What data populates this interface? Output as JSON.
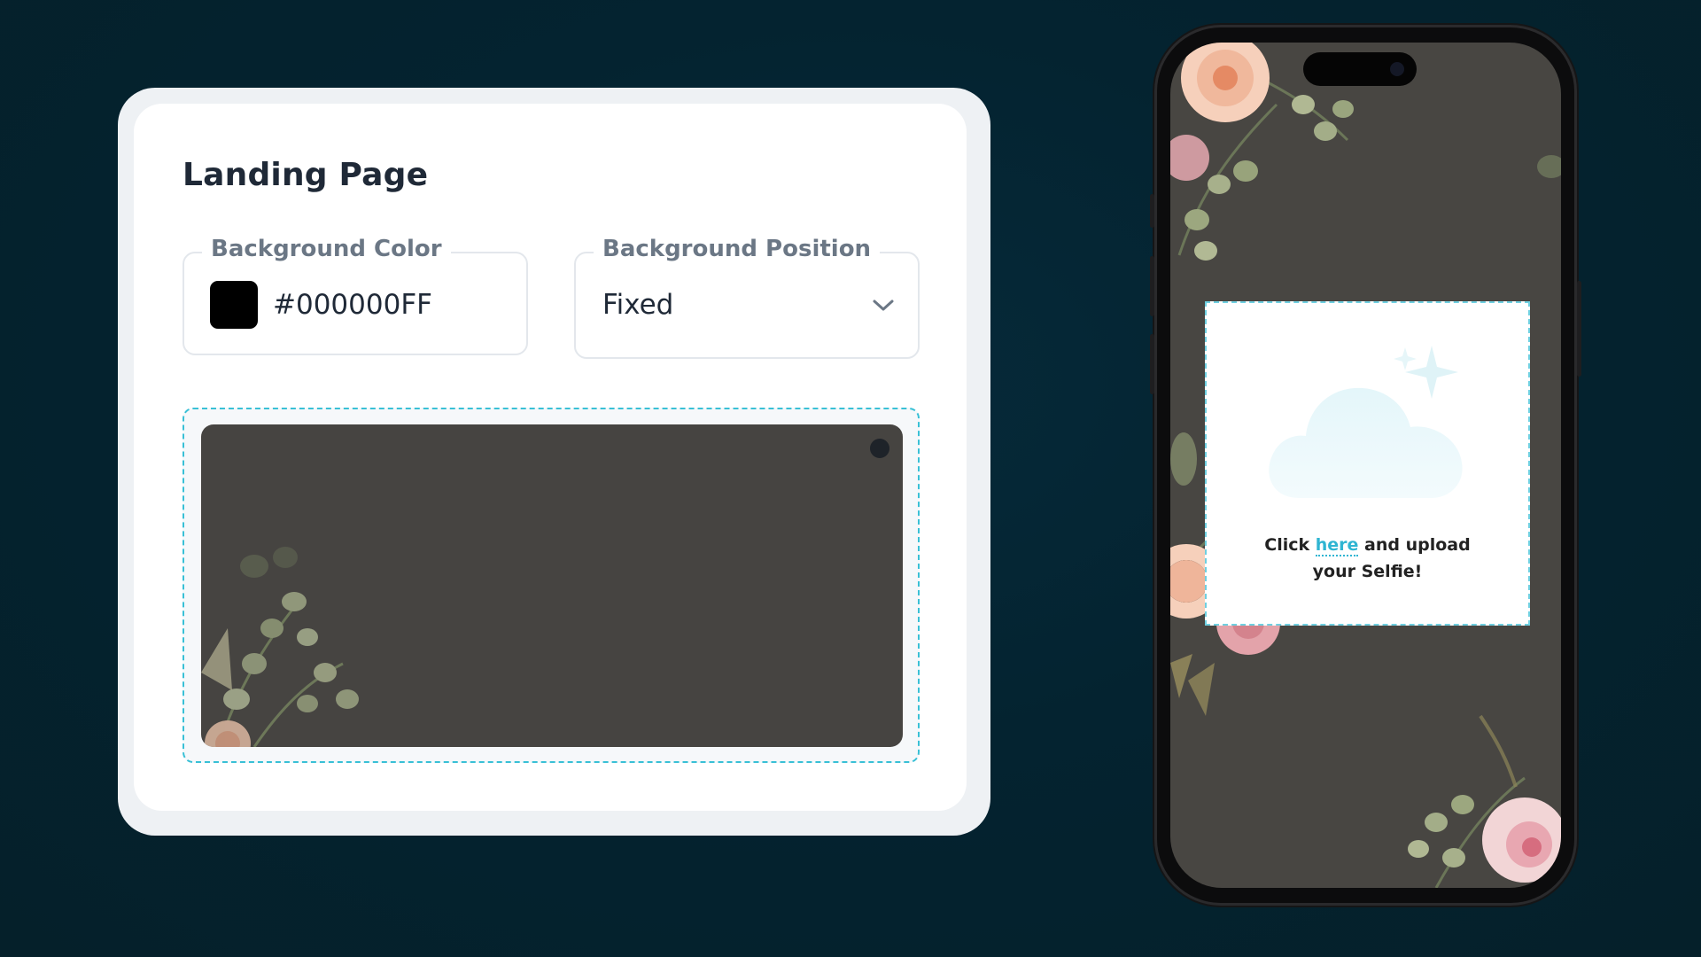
{
  "settings": {
    "title": "Landing Page",
    "background_color": {
      "label": "Background Color",
      "value": "#000000FF",
      "swatch": "#000000"
    },
    "background_position": {
      "label": "Background Position",
      "selected": "Fixed"
    }
  },
  "phone": {
    "upload": {
      "text_before": "Click",
      "link": "here",
      "text_after": "and upload",
      "line2": "your Selfie!"
    }
  },
  "colors": {
    "accent": "#39c0d6",
    "preview_bg": "#464441",
    "text": "#1f2937"
  }
}
